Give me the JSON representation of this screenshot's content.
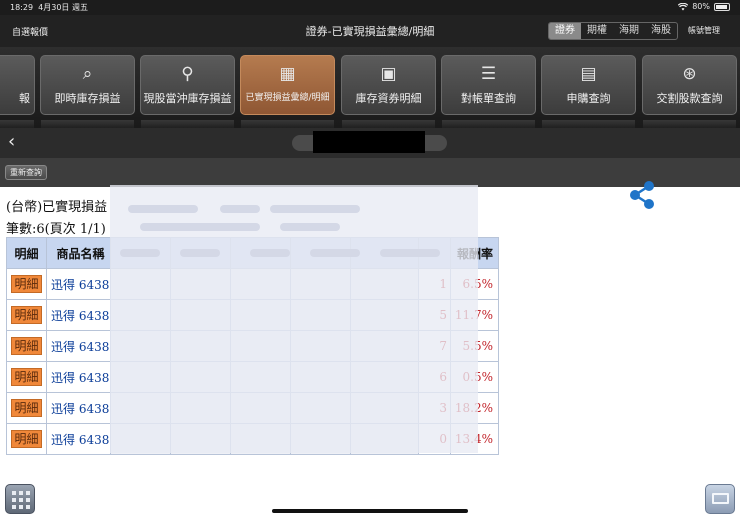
{
  "status_bar": {
    "time": "18:29",
    "date": "4月30日 週五",
    "battery": "80%"
  },
  "header": {
    "favorites": "自選報價",
    "title": "證券-已實現損益彙總/明細",
    "segments": [
      "證券",
      "期權",
      "海期",
      "海股"
    ],
    "active_segment": "證券",
    "account_management": "帳號管理"
  },
  "toolbar": {
    "buttons": [
      {
        "label": "報",
        "icon": "report-icon"
      },
      {
        "label": "即時庫存損益",
        "icon": "inventory-pnl-icon"
      },
      {
        "label": "現股當沖庫存損益",
        "icon": "daytrade-icon"
      },
      {
        "label": "已實現損益彙總/明細",
        "icon": "realized-pnl-icon",
        "active": true
      },
      {
        "label": "庫存資券明細",
        "icon": "margin-detail-icon"
      },
      {
        "label": "對帳單查詢",
        "icon": "statement-icon"
      },
      {
        "label": "申購查詢",
        "icon": "subscription-icon"
      },
      {
        "label": "交割股款查詢",
        "icon": "settlement-icon"
      }
    ]
  },
  "requery_label": "重新查詢",
  "summary": {
    "caption_prefix": "(台幣)已實現損益",
    "record_count": "筆數:6(頁次 1/1)"
  },
  "table": {
    "headers": {
      "detail": "明細",
      "name": "商品名稱",
      "rate": "報酬率"
    },
    "rows": [
      {
        "detail": "明細",
        "name": "迅得 6438",
        "ret_tail": "1",
        "rate": "6.5%"
      },
      {
        "detail": "明細",
        "name": "迅得 6438",
        "ret_tail": "5",
        "rate": "11.7%"
      },
      {
        "detail": "明細",
        "name": "迅得 6438",
        "ret_tail": "7",
        "rate": "5.5%"
      },
      {
        "detail": "明細",
        "name": "迅得 6438",
        "ret_tail": "6",
        "rate": "0.5%"
      },
      {
        "detail": "明細",
        "name": "迅得 6438",
        "ret_tail": "3",
        "rate": "18.2%"
      },
      {
        "detail": "明細",
        "name": "迅得 6438",
        "ret_tail": "0",
        "rate": "13.4%"
      }
    ]
  },
  "colors": {
    "accent_active": "#a86a40",
    "rate_red": "#c2252c",
    "header_blue": "#c7d6f0"
  }
}
